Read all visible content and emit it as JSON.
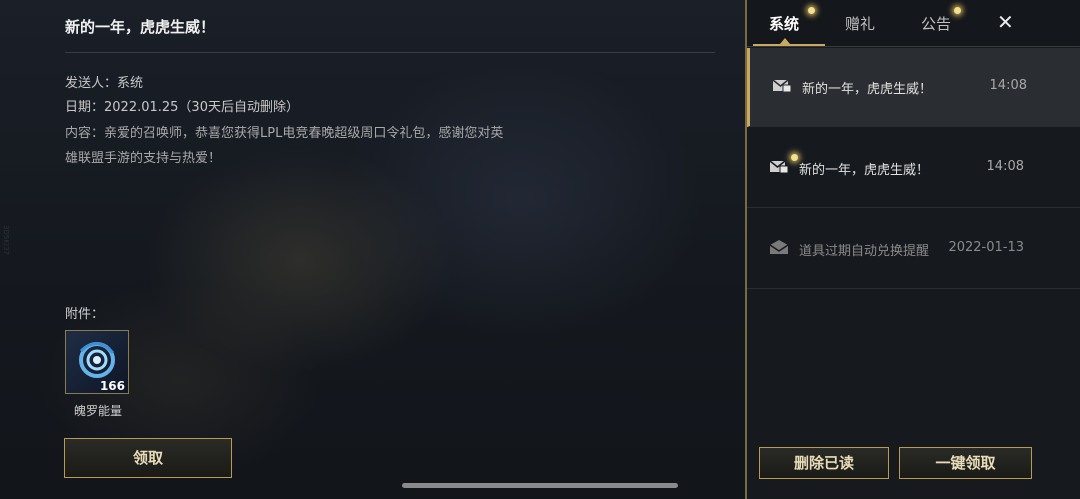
{
  "mail": {
    "title": "新的一年，虎虎生威！",
    "sender_line": "发送人：系统",
    "date_line": "日期：2022.01.25（30天后自动删除）",
    "content_line1": "内容：亲爱的召唤师，恭喜您获得LPL电竞春晚超级周口令礼包，感谢您对英",
    "content_line2": "雄联盟手游的支持与热爱！",
    "attachment_label": "附件：",
    "attachment": {
      "name": "魄罗能量",
      "count": "166",
      "icon": "poro-energy-icon"
    },
    "claim_label": "领取"
  },
  "side_mark": "3D5KJ37",
  "panel": {
    "tabs": [
      {
        "label": "系统",
        "active": true,
        "dot": true
      },
      {
        "label": "赠礼",
        "active": false,
        "dot": false
      },
      {
        "label": "公告",
        "active": false,
        "dot": true
      }
    ],
    "close_icon": "close-icon",
    "items": [
      {
        "title": "新的一年，虎虎生威！",
        "time": "14:08",
        "state": "selected",
        "icon": "mail-gift-icon"
      },
      {
        "title": "新的一年，虎虎生威！",
        "time": "14:08",
        "state": "unread",
        "icon": "mail-gift-icon"
      },
      {
        "title": "道具过期自动兑换提醒",
        "time": "2022-01-13",
        "state": "read",
        "icon": "mail-open-icon"
      }
    ],
    "delete_read_label": "删除已读",
    "claim_all_label": "一键领取"
  },
  "colors": {
    "accent": "#c9a862",
    "panel_bg": "#161a1f",
    "dot": "#f5e08a"
  }
}
